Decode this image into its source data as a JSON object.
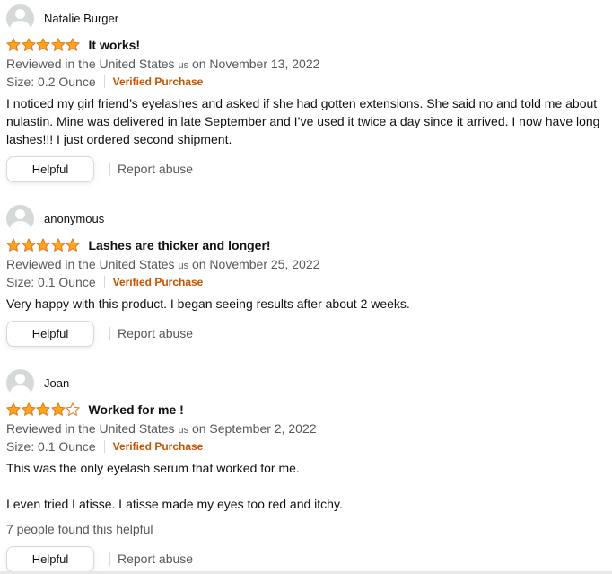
{
  "colors": {
    "star": "#ffa41c",
    "star_outline": "#de7921",
    "verified": "#c45500",
    "muted": "#565959",
    "text": "#0f1111"
  },
  "reviews": [
    {
      "author": "Natalie Burger",
      "avatar_icon": "default-user-avatar-icon",
      "rating": 5,
      "title": "It works!",
      "location_prefix": "Reviewed in the United States",
      "country_code": "us",
      "date": "on November 13, 2022",
      "size": "Size: 0.2 Ounce",
      "verified": "Verified Purchase",
      "body": [
        "I noticed my girl friend’s eyelashes and asked if she had gotten extensions. She said no and told me about nulastin. Mine was delivered in late September and I’ve used it twice a day since it arrived. I now have long lashes!!! I just ordered second shipment."
      ],
      "helpful_count_text": "",
      "helpful_label": "Helpful",
      "report_label": "Report abuse"
    },
    {
      "author": "anonymous",
      "avatar_icon": "default-user-avatar-icon",
      "rating": 5,
      "title": "Lashes are thicker and longer!",
      "location_prefix": "Reviewed in the United States",
      "country_code": "us",
      "date": "on November 25, 2022",
      "size": "Size: 0.1 Ounce",
      "verified": "Verified Purchase",
      "body": [
        "Very happy with this product. I began seeing results after about 2 weeks."
      ],
      "helpful_count_text": "",
      "helpful_label": "Helpful",
      "report_label": "Report abuse"
    },
    {
      "author": "Joan",
      "avatar_icon": "default-user-avatar-icon",
      "rating": 4,
      "title": "Worked for me !",
      "location_prefix": "Reviewed in the United States",
      "country_code": "us",
      "date": "on September 2, 2022",
      "size": "Size: 0.1 Ounce",
      "verified": "Verified Purchase",
      "body": [
        "This was the only eyelash serum that worked for me.",
        "I even tried Latisse. Latisse made my eyes too red and itchy."
      ],
      "helpful_count_text": "7 people found this helpful",
      "helpful_label": "Helpful",
      "report_label": "Report abuse"
    }
  ]
}
